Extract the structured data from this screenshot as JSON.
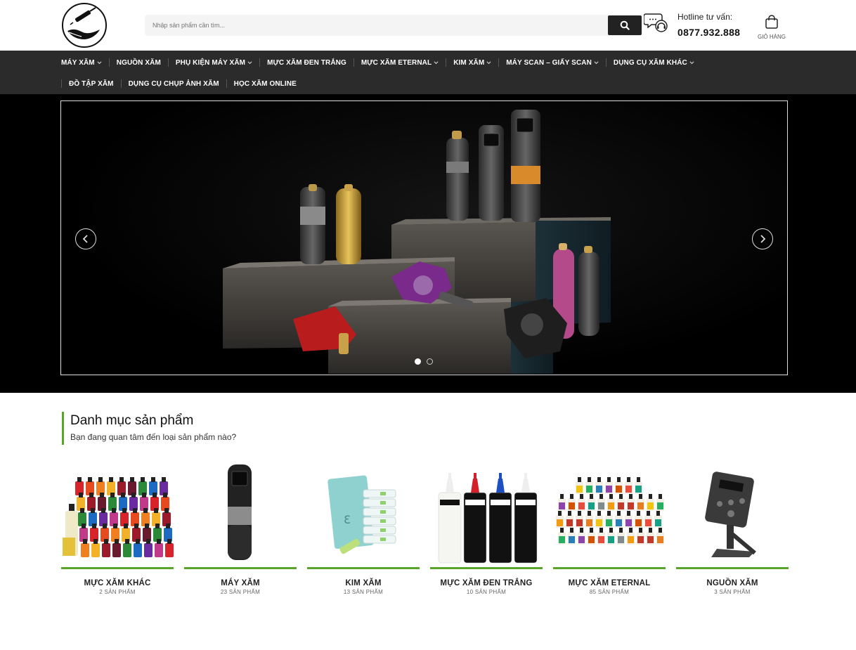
{
  "header": {
    "logo_name": "tattoo-hand-logo",
    "search_placeholder": "Nhập sản phẩm cần tìm...",
    "hotline_label": "Hotline tư vấn:",
    "hotline_phone": "0877.932.888",
    "cart_label": "GIỎ HÀNG"
  },
  "nav": {
    "row1": [
      {
        "label": "MÁY XĂM",
        "dropdown": true
      },
      {
        "label": "NGUỒN XĂM",
        "dropdown": false
      },
      {
        "label": "PHỤ KIỆN MÁY XĂM",
        "dropdown": true
      },
      {
        "label": "MỰC XĂM ĐEN TRẮNG",
        "dropdown": false
      },
      {
        "label": "MỰC XĂM ETERNAL",
        "dropdown": true
      },
      {
        "label": "KIM XĂM",
        "dropdown": true
      },
      {
        "label": "MÁY SCAN – GIẤY SCAN",
        "dropdown": true
      },
      {
        "label": "DỤNG CỤ XĂM KHÁC",
        "dropdown": true
      }
    ],
    "row2": [
      {
        "label": "ĐỒ TẬP XĂM",
        "dropdown": false
      },
      {
        "label": "DỤNG CỤ CHỤP ẢNH XĂM",
        "dropdown": false
      },
      {
        "label": "HỌC XĂM ONLINE",
        "dropdown": false
      }
    ]
  },
  "hero": {
    "slides_count": 2,
    "active_slide": 1
  },
  "categories_section": {
    "title": "Danh mục sản phẩm",
    "subtitle": "Bạn đang quan tâm đến loại sản phẩm nào?",
    "items": [
      {
        "name": "MỰC XĂM KHÁC",
        "count": "2 SẢN PHẨM",
        "image": "colorful-ink-bottles"
      },
      {
        "name": "MÁY XĂM",
        "count": "23 SẢN PHẨM",
        "image": "pen-tattoo-machine"
      },
      {
        "name": "KIM XĂM",
        "count": "13 SẢN PHẨM",
        "image": "needle-cartridges"
      },
      {
        "name": "MỰC XĂM ĐEN TRẮNG",
        "count": "10 SẢN PHẨM",
        "image": "dynamic-ink-bottles"
      },
      {
        "name": "MỰC XĂM ETERNAL",
        "count": "85 SẢN PHẨM",
        "image": "eternal-ink-set"
      },
      {
        "name": "NGUỒN XĂM",
        "count": "3 SẢN PHẨM",
        "image": "power-supply"
      }
    ]
  },
  "colors": {
    "nav_bg": "#2b2b2b",
    "accent_green": "#59a52c",
    "hero_bg": "#000000"
  }
}
